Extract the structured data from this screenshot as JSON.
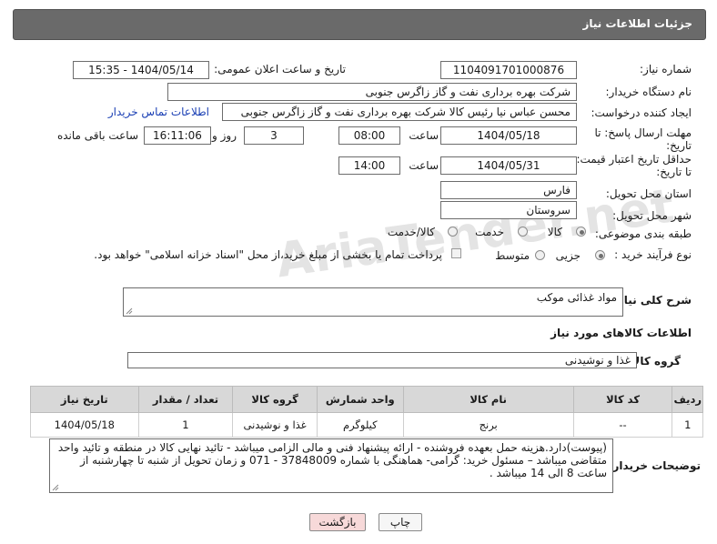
{
  "header": {
    "title": "جزئیات اطلاعات نیاز"
  },
  "fields": {
    "need_number_label": "شماره نیاز:",
    "need_number": "1104091701000876",
    "announce_label": "تاریخ و ساعت اعلان عمومی:",
    "announce_value": "1404/05/14 - 15:35",
    "buyer_org_label": "نام دستگاه خریدار:",
    "buyer_org": "شرکت بهره برداری نفت و گاز زاگرس جنوبی",
    "creator_label": "ایجاد کننده درخواست:",
    "creator": "محسن عباس نیا رئیس کالا شرکت بهره برداری نفت و گاز زاگرس جنوبی",
    "contact_link": "اطلاعات تماس خریدار",
    "deadline_label_1": "مهلت ارسال پاسخ: تا",
    "deadline_label_2": "تاریخ:",
    "deadline_date": "1404/05/18",
    "hour_label": "ساعت",
    "deadline_time": "08:00",
    "days_value": "3",
    "days_label": "روز و",
    "remaining_time": "16:11:06",
    "remaining_label": "ساعت باقی مانده",
    "validity_label_1": "حداقل تاریخ اعتبار قیمت:",
    "validity_label_2": "تا تاریخ:",
    "validity_date": "1404/05/31",
    "validity_hour_label": "ساعت",
    "validity_time": "14:00",
    "province_label": "استان محل تحویل:",
    "province": "فارس",
    "city_label": "شهر محل تحویل:",
    "city": "سروستان",
    "category_label": "طبقه بندی موضوعی:",
    "category_options": [
      "کالا",
      "خدمت",
      "کالا/خدمت"
    ],
    "category_selected": "کالا",
    "process_label": "نوع فرآیند خرید :",
    "process_options": [
      "جزیی",
      "متوسط"
    ],
    "process_selected": "جزیی",
    "payment_note": "پرداخت تمام یا بخشی از مبلغ خرید،از محل \"اسناد خزانه اسلامی\" خواهد بود.",
    "description_label": "شرح کلی نیاز:",
    "description": "مواد غذائی موکب",
    "goods_section_title": "اطلاعات کالاهای مورد نیاز",
    "goods_group_label": "گروه کالا:",
    "goods_group": "غذا و نوشیدنی",
    "buyer_notes_label": "توضیحات خریدار:",
    "buyer_notes": "(پیوست)دارد.هزینه حمل بعهده فروشنده - ارائه پیشنهاد فنی و مالی الزامی میباشد - تائید نهایی کالا در منطقه و تائید واحد متقاضی میباشد – مسئول خرید: گرامی- هماهنگی با شماره 37848009 - 071 و زمان تحویل از شنبه تا چهارشنبه از ساعت 8 الی 14 میباشد ."
  },
  "table": {
    "headers": [
      "ردیف",
      "کد کالا",
      "نام کالا",
      "واحد شمارش",
      "گروه کالا",
      "تعداد / مقدار",
      "تاریخ نیاز"
    ],
    "rows": [
      [
        "1",
        "--",
        "برنج",
        "کیلوگرم",
        "غذا و نوشیدنی",
        "1",
        "1404/05/18"
      ]
    ]
  },
  "buttons": {
    "print": "چاپ",
    "back": "بازگشت"
  },
  "watermark": "AriaTender.net",
  "colors": {
    "header_bg": "#6a6a6a",
    "link": "#1a3fb4",
    "back_button_bg": "#f7d9d9"
  }
}
